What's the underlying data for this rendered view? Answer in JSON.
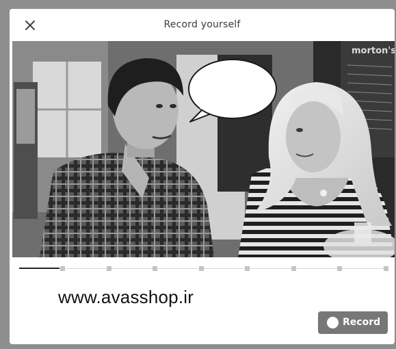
{
  "dialog": {
    "title": "Record yourself",
    "close_icon": "close-icon"
  },
  "video": {
    "sign_text": "morton's",
    "progress_fraction": 0.11,
    "marker_count": 9
  },
  "watermark": "www.avasshop.ir",
  "record_button": {
    "label": "Record",
    "icon": "record-dot-icon"
  },
  "colors": {
    "button_bg": "#777777",
    "progress": "#222222",
    "track": "#d8d8d8"
  }
}
